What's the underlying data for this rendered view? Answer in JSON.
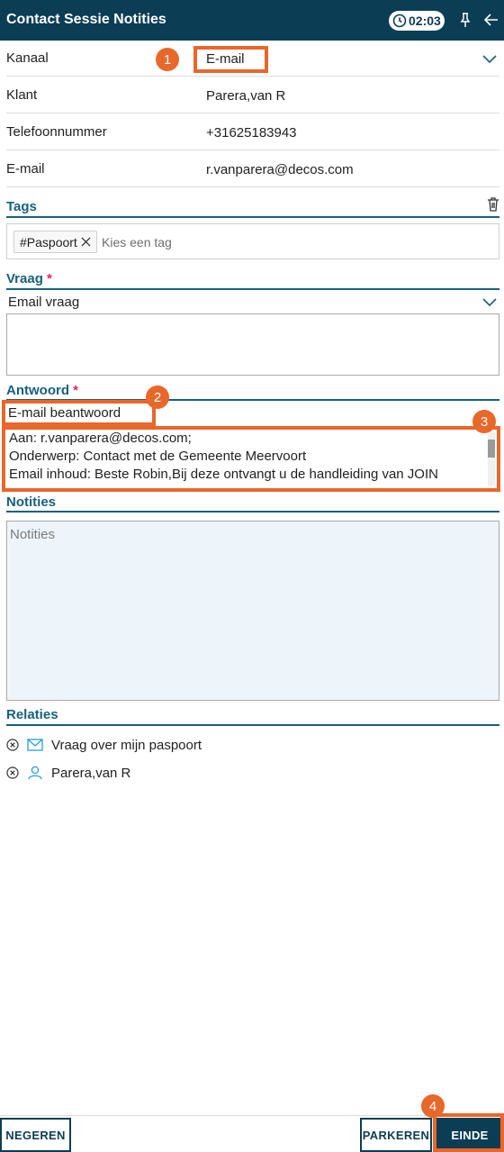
{
  "header": {
    "title": "Contact Sessie Notities",
    "timer": "02:03"
  },
  "fields": [
    {
      "label": "Kanaal",
      "value": "E-mail"
    },
    {
      "label": "Klant",
      "value": "Parera,van R"
    },
    {
      "label": "Telefoonnummer",
      "value": "+31625183943"
    },
    {
      "label": "E-mail",
      "value": "r.vanparera@decos.com"
    }
  ],
  "tags": {
    "title": "Tags",
    "chip": "#Paspoort",
    "placeholder": "Kies een tag"
  },
  "vraag": {
    "title": "Vraag",
    "required_mark": "*",
    "selected": "Email vraag"
  },
  "antwoord": {
    "title": "Antwoord",
    "required_mark": "*",
    "selected": "E-mail beantwoord",
    "lines": [
      "Aan: r.vanparera@decos.com;",
      "Onderwerp: Contact met de Gemeente Meervoort",
      "Email inhoud:   Beste Robin,Bij deze ontvangt u de handleiding van JOIN"
    ]
  },
  "notities": {
    "title": "Notities",
    "placeholder": "Notities"
  },
  "relaties": {
    "title": "Relaties",
    "items": [
      {
        "label": "Vraag over mijn paspoort",
        "icon": "mail-icon"
      },
      {
        "label": "Parera,van R",
        "icon": "person-icon"
      }
    ]
  },
  "buttons": {
    "negeren": "NEGEREN",
    "parkeren": "PARKEREN",
    "einde": "EINDE"
  },
  "annotations": [
    "1",
    "2",
    "3",
    "4"
  ],
  "colors": {
    "header": "#0b3d55",
    "accent": "#17607f",
    "highlight": "#e8672a",
    "required": "#e0245e"
  }
}
